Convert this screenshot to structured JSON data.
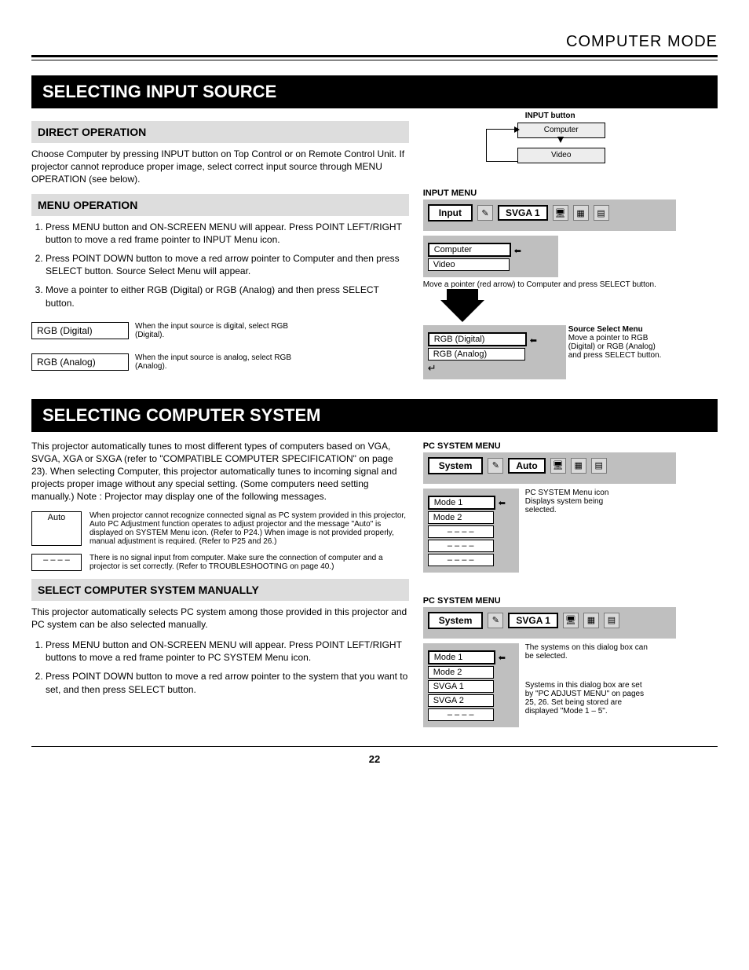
{
  "chapter": "COMPUTER MODE",
  "sections": {
    "source": {
      "title": "SELECTING INPUT SOURCE",
      "direct": {
        "heading": "DIRECT OPERATION",
        "text": "Choose Computer by pressing INPUT button on Top Control or on Remote Control Unit.\nIf projector cannot reproduce proper image, select correct input source through MENU OPERATION (see below).",
        "flow": {
          "title": "INPUT button",
          "box1": "Computer",
          "box2": "Video"
        }
      },
      "menu": {
        "heading": "MENU OPERATION",
        "steps": [
          "Press MENU button and ON-SCREEN MENU will appear. Press POINT LEFT/RIGHT button to move a red frame pointer to INPUT Menu icon.",
          "Press POINT DOWN button to move a red arrow pointer to Computer and then press SELECT button. Source Select Menu will appear.",
          "Move a pointer to either RGB (Digital) or RGB (Analog) and then press SELECT button."
        ],
        "buttons": {
          "digital": {
            "label": "RGB (Digital)",
            "desc": "When the input source is digital, select RGB (Digital)."
          },
          "analog": {
            "label": "RGB (Analog)",
            "desc": "When the input source is analog, select RGB (Analog)."
          }
        },
        "osd_input": {
          "title_label": "INPUT MENU",
          "menu_btn": "Input",
          "chip": "SVGA 1",
          "items": [
            "Computer",
            "Video"
          ],
          "callout1": "Move a pointer (red arrow) to Computer and press SELECT button."
        },
        "osd_source": {
          "items": [
            "RGB (Digital)",
            "RGB (Analog)"
          ],
          "callout": "Move a pointer to RGB (Digital) or RGB (Analog) and press SELECT button.",
          "side_label": "Source Select Menu"
        }
      }
    },
    "system": {
      "title": "SELECTING COMPUTER SYSTEM",
      "intro": "This projector automatically tunes to most different types of computers based on VGA, SVGA, XGA or SXGA (refer to \"COMPATIBLE COMPUTER SPECIFICATION\" on page 23). When selecting Computer, this projector automatically tunes to incoming signal and projects proper image without any special setting. (Some computers need setting manually.)\nNote : Projector may display one of the following messages.",
      "auto_row": {
        "label": "Auto",
        "text": "When projector cannot recognize connected signal as PC system provided in this projector, Auto PC Adjustment function operates to adjust projector and the message \"Auto\" is displayed on SYSTEM Menu icon. (Refer to P24.) When image is not provided properly, manual adjustment is required. (Refer to P25 and 26.)"
      },
      "nosig_row": {
        "label": "– – – –",
        "text": "There is no signal input from computer. Make sure the connection of computer and a projector is set correctly. (Refer to TROUBLESHOOTING on page 40.)"
      },
      "manual": {
        "heading": "SELECT COMPUTER SYSTEM MANUALLY",
        "text": "This projector automatically selects PC system among those provided in this projector and PC system can be also selected manually.",
        "steps": [
          "Press MENU button and ON-SCREEN MENU will appear. Press POINT LEFT/RIGHT buttons to move a red frame pointer to PC SYSTEM Menu icon.",
          "Press POINT DOWN button to move a red arrow pointer to the system that you want to set, and then press SELECT button."
        ]
      },
      "osd_auto": {
        "title_label": "PC SYSTEM MENU",
        "menu_btn": "System",
        "chip": "Auto",
        "items": [
          "Mode 1",
          "Mode 2",
          "– – – –",
          "– – – –",
          "– – – –"
        ],
        "right_note": "PC SYSTEM Menu icon\nDisplays system being selected."
      },
      "osd_manual": {
        "title_label": "PC SYSTEM MENU",
        "menu_btn": "System",
        "chip": "SVGA 1",
        "items": [
          "Mode 1",
          "Mode 2",
          "SVGA 1",
          "SVGA 2",
          "– – – –"
        ],
        "right_note_top": "The systems on this dialog box can be selected.",
        "right_note_bottom": "Systems in this dialog box are set by \"PC ADJUST MENU\" on pages 25, 26. Set being stored are displayed \"Mode 1 – 5\"."
      }
    }
  },
  "page_number": "22"
}
